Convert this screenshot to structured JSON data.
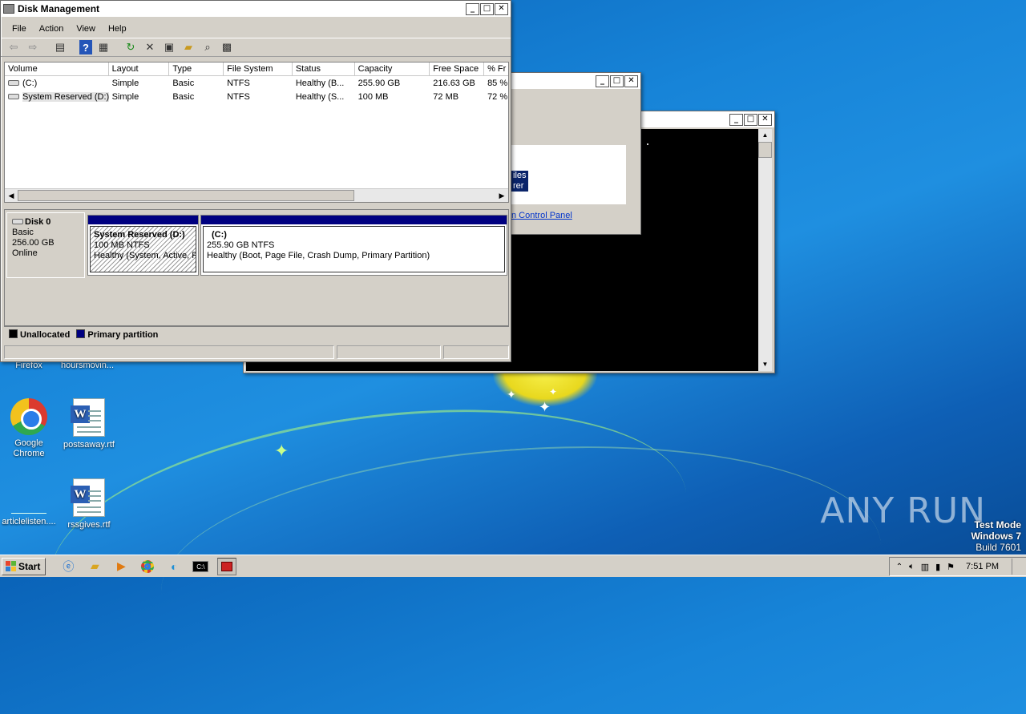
{
  "desktop": {
    "icons": [
      {
        "label": "Firefox"
      },
      {
        "label": "hoursmovin..."
      },
      {
        "label": "Google Chrome"
      },
      {
        "label": "postsaway.rtf"
      },
      {
        "label": "articlelisten...."
      },
      {
        "label": "rssgives.rtf"
      }
    ],
    "watermark": "ANY RUN",
    "test_mode": {
      "line1": "Test Mode",
      "line2": "Windows 7",
      "line3": "Build 7601"
    }
  },
  "bg_window": {
    "text1": "iles",
    "text2": "rer",
    "link": "n Control Panel"
  },
  "disk_management": {
    "title": "Disk Management",
    "menu": [
      "File",
      "Action",
      "View",
      "Help"
    ],
    "columns": [
      "Volume",
      "Layout",
      "Type",
      "File System",
      "Status",
      "Capacity",
      "Free Space",
      "% Fr"
    ],
    "rows": [
      [
        "(C:)",
        "Simple",
        "Basic",
        "NTFS",
        "Healthy (B...",
        "255.90 GB",
        "216.63 GB",
        "85 %"
      ],
      [
        "System Reserved (D:)",
        "Simple",
        "Basic",
        "NTFS",
        "Healthy (S...",
        "100 MB",
        "72 MB",
        "72 %"
      ]
    ],
    "disk": {
      "name": "Disk 0",
      "type": "Basic",
      "size": "256.00 GB",
      "state": "Online"
    },
    "partitions": [
      {
        "name": "System Reserved  (D:)",
        "size": "100 MB NTFS",
        "status": "Healthy (System, Active, P"
      },
      {
        "name": "(C:)",
        "size": "255.90 GB NTFS",
        "status": "Healthy (Boot, Page File, Crash Dump, Primary Partition)"
      }
    ],
    "legend": {
      "unallocated": "Unallocated",
      "primary": "Primary partition"
    },
    "colors": {
      "primary": "#000080",
      "unallocated": "#000000"
    }
  },
  "taskbar": {
    "start": "Start",
    "clock": "7:51 PM"
  }
}
